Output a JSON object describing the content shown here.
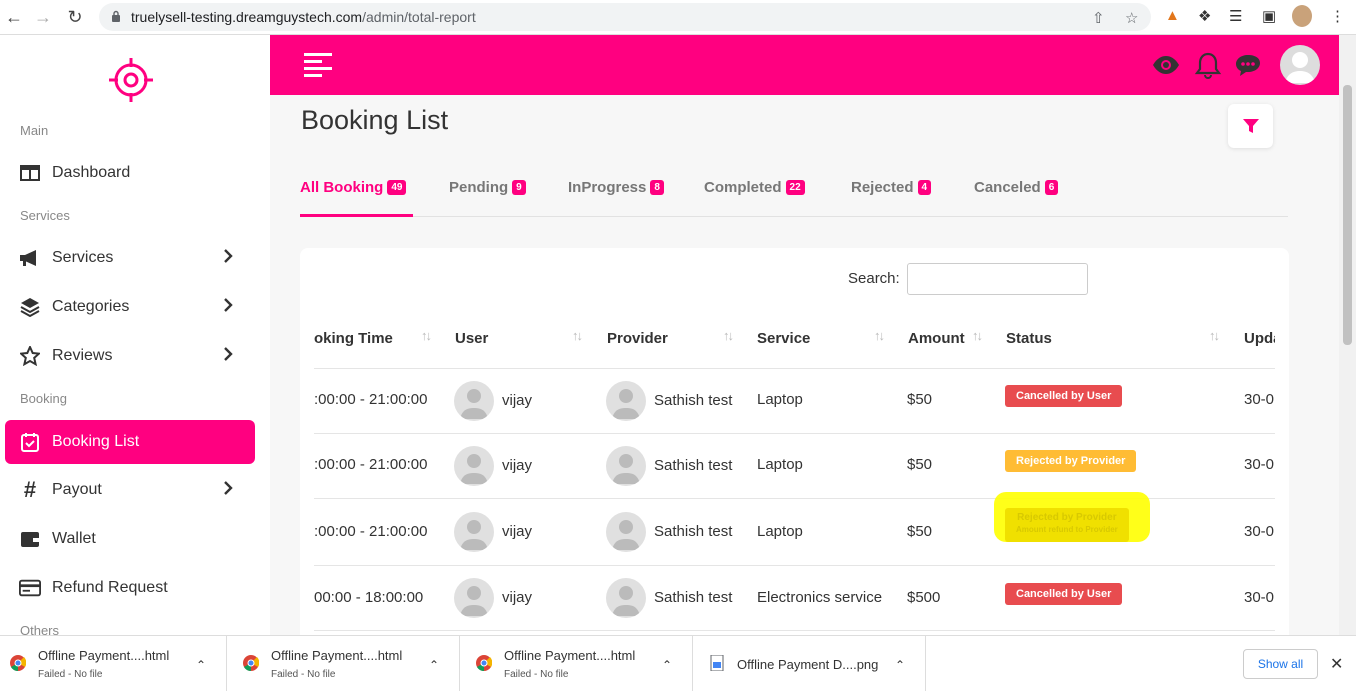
{
  "browser": {
    "url_domain": "truelysell-testing.dreamguystech.com",
    "url_path": "/admin/total-report"
  },
  "sidebar": {
    "sections": {
      "main": "Main",
      "services": "Services",
      "booking": "Booking",
      "others": "Others"
    },
    "items": [
      {
        "label": "Dashboard",
        "icon": "columns-icon"
      },
      {
        "label": "Services",
        "icon": "megaphone-icon"
      },
      {
        "label": "Categories",
        "icon": "layers-icon"
      },
      {
        "label": "Reviews",
        "icon": "star-icon"
      },
      {
        "label": "Booking List",
        "icon": "calendar-check-icon",
        "active": true
      },
      {
        "label": "Payout",
        "icon": "hash-icon"
      },
      {
        "label": "Wallet",
        "icon": "wallet-icon"
      },
      {
        "label": "Refund Request",
        "icon": "credit-card-icon"
      }
    ]
  },
  "page": {
    "title": "Booking List",
    "tabs": [
      {
        "label": "All Booking",
        "count": "49"
      },
      {
        "label": "Pending",
        "count": "9"
      },
      {
        "label": "InProgress",
        "count": "8"
      },
      {
        "label": "Completed",
        "count": "22"
      },
      {
        "label": "Rejected",
        "count": "4"
      },
      {
        "label": "Canceled",
        "count": "6"
      }
    ],
    "search_label": "Search:"
  },
  "table": {
    "headers": [
      "oking Time",
      "User",
      "Provider",
      "Service",
      "Amount",
      "Status",
      "Upda"
    ],
    "rows": [
      {
        "time": ":00:00 - 21:00:00",
        "user": "vijay",
        "provider": "Sathish test",
        "service": "Laptop",
        "amount": "$50",
        "status": "Cancelled by User",
        "status_sub": "",
        "updated": "30-0"
      },
      {
        "time": ":00:00 - 21:00:00",
        "user": "vijay",
        "provider": "Sathish test",
        "service": "Laptop",
        "amount": "$50",
        "status": "Rejected by Provider",
        "status_sub": "",
        "updated": "30-0"
      },
      {
        "time": ":00:00 - 21:00:00",
        "user": "vijay",
        "provider": "Sathish test",
        "service": "Laptop",
        "amount": "$50",
        "status": "Rejected by Provider",
        "status_sub": "Amount refund to Provider",
        "updated": "30-0"
      },
      {
        "time": "00:00 - 18:00:00",
        "user": "vijay",
        "provider": "Sathish test",
        "service": "Electronics service",
        "amount": "$500",
        "status": "Cancelled by User",
        "status_sub": "",
        "updated": "30-0"
      }
    ]
  },
  "downloads": [
    {
      "name": "Offline Payment....html",
      "status": "Failed - No file"
    },
    {
      "name": "Offline Payment....html",
      "status": "Failed - No file"
    },
    {
      "name": "Offline Payment....html",
      "status": "Failed - No file"
    },
    {
      "name": "Offline Payment D....png",
      "status": ""
    }
  ],
  "downloads_show_all": "Show all",
  "colors": {
    "brand": "#ff0080",
    "cancelled": "#e84c4f",
    "rejected": "#ffbc34",
    "highlight": "#ffff00"
  }
}
